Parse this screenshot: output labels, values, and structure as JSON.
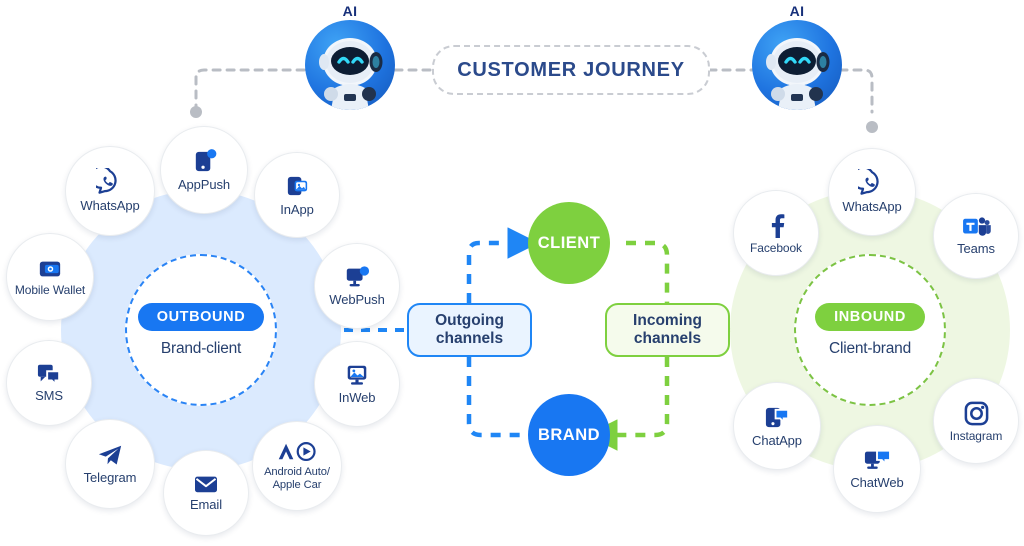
{
  "header": {
    "journey_label": "CUSTOMER JOURNEY",
    "ai_left_label": "AI",
    "ai_right_label": "AI",
    "ai_icon": "robot-avatar-icon"
  },
  "outbound": {
    "badge": "OUTBOUND",
    "subtitle": "Brand-client",
    "accent_color": "#1877f2",
    "blob_color": "#dbeafe",
    "channels": [
      {
        "label": "AppPush",
        "icon": "app-push-icon"
      },
      {
        "label": "InApp",
        "icon": "in-app-icon"
      },
      {
        "label": "WebPush",
        "icon": "web-push-icon"
      },
      {
        "label": "InWeb",
        "icon": "in-web-icon"
      },
      {
        "label": "Android Auto/ Apple Car",
        "icon": "android-auto-apple-car-icon"
      },
      {
        "label": "Email",
        "icon": "email-icon"
      },
      {
        "label": "Telegram",
        "icon": "telegram-icon"
      },
      {
        "label": "SMS",
        "icon": "sms-icon"
      },
      {
        "label": "Mobile Wallet",
        "icon": "mobile-wallet-icon"
      },
      {
        "label": "WhatsApp",
        "icon": "whatsapp-icon"
      }
    ]
  },
  "inbound": {
    "badge": "INBOUND",
    "subtitle": "Client-brand",
    "accent_color": "#7ed03f",
    "blob_color": "#eef7e2",
    "channels": [
      {
        "label": "WhatsApp",
        "icon": "whatsapp-icon"
      },
      {
        "label": "Teams",
        "icon": "microsoft-teams-icon"
      },
      {
        "label": "Instagram",
        "icon": "instagram-icon"
      },
      {
        "label": "ChatWeb",
        "icon": "chat-web-icon"
      },
      {
        "label": "ChatApp",
        "icon": "chat-app-icon"
      },
      {
        "label": "Facebook",
        "icon": "facebook-icon"
      }
    ]
  },
  "center": {
    "client_label": "CLIENT",
    "brand_label": "BRAND",
    "client_color": "#7ed03f",
    "brand_color": "#1877f2",
    "outgoing_line1": "Outgoing",
    "outgoing_line2": "channels",
    "incoming_line1": "Incoming",
    "incoming_line2": "channels"
  }
}
